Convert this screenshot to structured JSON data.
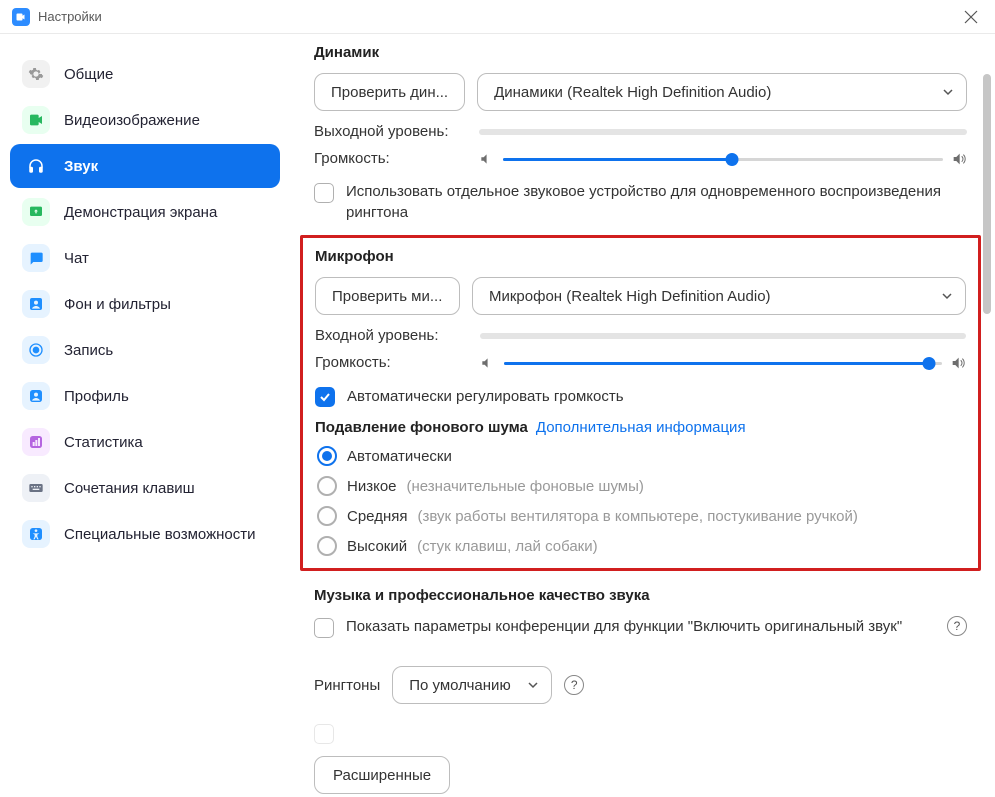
{
  "window": {
    "title": "Настройки"
  },
  "sidebar": {
    "items": [
      {
        "label": "Общие"
      },
      {
        "label": "Видеоизображение"
      },
      {
        "label": "Звук"
      },
      {
        "label": "Демонстрация экрана"
      },
      {
        "label": "Чат"
      },
      {
        "label": "Фон и фильтры"
      },
      {
        "label": "Запись"
      },
      {
        "label": "Профиль"
      },
      {
        "label": "Статистика"
      },
      {
        "label": "Сочетания клавиш"
      },
      {
        "label": "Специальные возможности"
      }
    ],
    "active_index": 2
  },
  "speaker": {
    "title": "Динамик",
    "test_button": "Проверить дин...",
    "device": "Динамики (Realtek High Definition Audio)",
    "output_level_label": "Выходной уровень:",
    "volume_label": "Громкость:",
    "volume_percent": 52,
    "separate_device_label": "Использовать отдельное звуковое устройство для одновременного воспроизведения рингтона",
    "separate_device_checked": false
  },
  "microphone": {
    "title": "Микрофон",
    "test_button": "Проверить ми...",
    "device": "Микрофон (Realtek High Definition Audio)",
    "input_level_label": "Входной уровень:",
    "volume_label": "Громкость:",
    "volume_percent": 97,
    "auto_adjust_label": "Автоматически регулировать громкость",
    "auto_adjust_checked": true,
    "noise": {
      "title": "Подавление фонового шума",
      "more_info": "Дополнительная информация",
      "selected": "auto",
      "options": [
        {
          "id": "auto",
          "label": "Автоматически",
          "hint": ""
        },
        {
          "id": "low",
          "label": "Низкое",
          "hint": "(незначительные фоновые шумы)"
        },
        {
          "id": "medium",
          "label": "Средняя",
          "hint": "(звук работы вентилятора в компьютере, постукивание ручкой)"
        },
        {
          "id": "high",
          "label": "Высокий",
          "hint": "(стук клавиш, лай собаки)"
        }
      ]
    }
  },
  "music": {
    "title": "Музыка и профессиональное качество звука",
    "original_sound_label": "Показать параметры конференции для функции \"Включить оригинальный звук\"",
    "original_sound_checked": false
  },
  "ringtone": {
    "label": "Рингтоны",
    "value": "По умолчанию"
  },
  "advanced_button": "Расширенные"
}
